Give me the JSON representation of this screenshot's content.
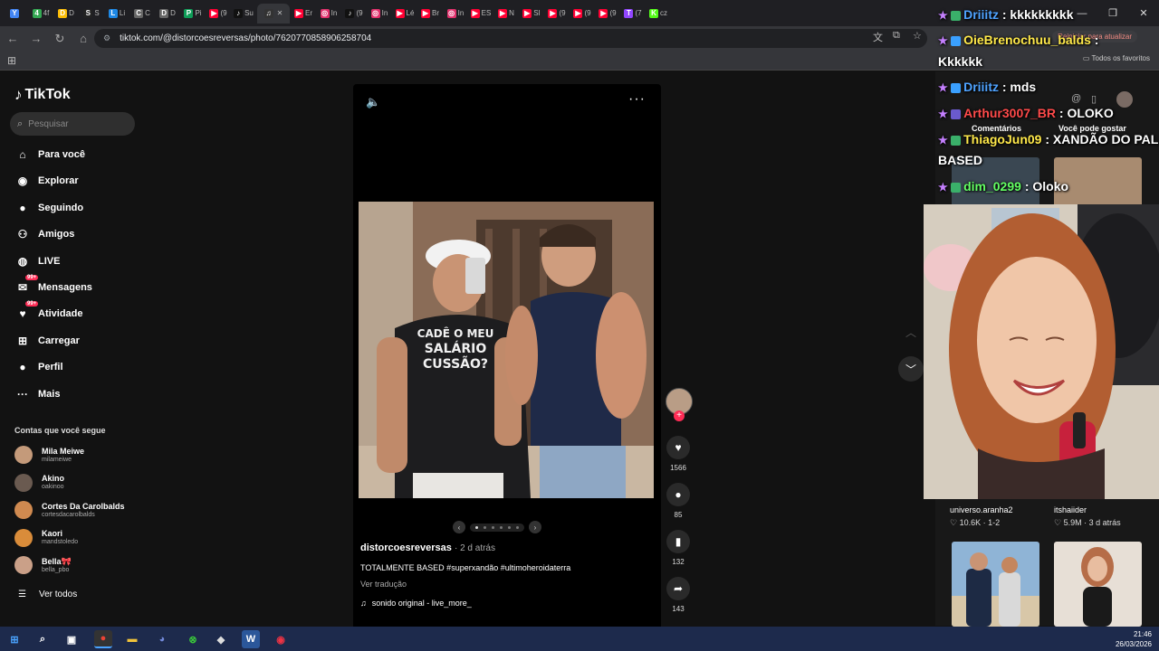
{
  "browser": {
    "url": "tiktok.com/@distorcoesreversas/photo/7620770858906258704",
    "update_label": "Reiniciar para atualizar",
    "favorites_label": "Todos os favoritos",
    "tabs": [
      {
        "fav": "Y",
        "color": "#4285f4",
        "text": ""
      },
      {
        "fav": "4",
        "color": "#34a853",
        "text": "4f"
      },
      {
        "fav": "D",
        "color": "#fbbc05",
        "text": "D"
      },
      {
        "fav": "S",
        "color": "#222",
        "text": "S"
      },
      {
        "fav": "L",
        "color": "#1e88e5",
        "text": "Li"
      },
      {
        "fav": "C",
        "color": "#666",
        "text": "C"
      },
      {
        "fav": "D",
        "color": "#666",
        "text": "D"
      },
      {
        "fav": "P",
        "color": "#0f9d58",
        "text": "Pi"
      },
      {
        "fav": "▶",
        "color": "#ff0033",
        "text": "(9"
      },
      {
        "fav": "♪",
        "color": "#111",
        "text": "Su"
      },
      {
        "fav": "♫",
        "color": "#333",
        "text": ""
      },
      {
        "fav": "▶",
        "color": "#ff0033",
        "text": "Er"
      },
      {
        "fav": "◎",
        "color": "#e1306c",
        "text": "In"
      },
      {
        "fav": "♪",
        "color": "#111",
        "text": "(9"
      },
      {
        "fav": "◎",
        "color": "#e1306c",
        "text": "In"
      },
      {
        "fav": "▶",
        "color": "#ff0033",
        "text": "Lé"
      },
      {
        "fav": "▶",
        "color": "#ff0033",
        "text": "Br"
      },
      {
        "fav": "◎",
        "color": "#e1306c",
        "text": "In"
      },
      {
        "fav": "▶",
        "color": "#ff0033",
        "text": "ES"
      },
      {
        "fav": "▶",
        "color": "#ff0033",
        "text": "N"
      },
      {
        "fav": "▶",
        "color": "#ff0033",
        "text": "SI"
      },
      {
        "fav": "▶",
        "color": "#ff0033",
        "text": "(9"
      },
      {
        "fav": "▶",
        "color": "#ff0033",
        "text": "(9"
      },
      {
        "fav": "▶",
        "color": "#ff0033",
        "text": "(9"
      },
      {
        "fav": "T",
        "color": "#9146ff",
        "text": "(7"
      },
      {
        "fav": "K",
        "color": "#53fc18",
        "text": "cz"
      }
    ]
  },
  "tiktok": {
    "logo": "TikTok",
    "search_placeholder": "Pesquisar",
    "nav": [
      {
        "icon": "home-icon",
        "glyph": "⌂",
        "label": "Para você",
        "badge": ""
      },
      {
        "icon": "compass-icon",
        "glyph": "◉",
        "label": "Explorar",
        "badge": ""
      },
      {
        "icon": "following-icon",
        "glyph": "●",
        "label": "Seguindo",
        "badge": ""
      },
      {
        "icon": "friends-icon",
        "glyph": "⚇",
        "label": "Amigos",
        "badge": ""
      },
      {
        "icon": "live-icon",
        "glyph": "◍",
        "label": "LIVE",
        "badge": ""
      },
      {
        "icon": "messages-icon",
        "glyph": "✉",
        "label": "Mensagens",
        "badge": "99+"
      },
      {
        "icon": "activity-icon",
        "glyph": "♥",
        "label": "Atividade",
        "badge": "99+"
      },
      {
        "icon": "upload-icon",
        "glyph": "⊞",
        "label": "Carregar",
        "badge": ""
      },
      {
        "icon": "profile-icon",
        "glyph": "●",
        "label": "Perfil",
        "badge": ""
      },
      {
        "icon": "more-icon",
        "glyph": "···",
        "label": "Mais",
        "badge": ""
      }
    ],
    "follows_title": "Contas que você segue",
    "follows": [
      {
        "name": "Mila Meiwe",
        "handle": "milameiwe",
        "color": "#c49a7a"
      },
      {
        "name": "Akino",
        "handle": "oakinoo",
        "color": "#6a5a50"
      },
      {
        "name": "Cortes Da Carolbalds",
        "handle": "cortesdacarolbalds",
        "color": "#d08a50"
      },
      {
        "name": "Kaori",
        "handle": "mandstoledo",
        "color": "#d98c3a"
      },
      {
        "name": "Bella🎀",
        "handle": "bella_pbo",
        "color": "#caa088"
      }
    ],
    "see_all": "Ver todos",
    "post": {
      "author": "distorcoesreversas",
      "time": "· 2 d atrás",
      "caption": "TOTALMENTE BASED #superxandão #ultimoheroidaterra",
      "translate": "Ver tradução",
      "sound": "sonido original - live_more_",
      "shirt_text": [
        "CADÊ O MEU",
        "SALÁRIO",
        "CUSSÃO?"
      ],
      "carousel_total": 6,
      "carousel_current": 1
    },
    "actions": {
      "likes": "1566",
      "comments": "85",
      "saves": "132",
      "shares": "143"
    },
    "right_panel": {
      "tab_comments": "Comentários",
      "tab_recommend": "Você pode gostar",
      "recs": [
        {
          "title": "universo.aranha2",
          "meta": "♡ 10.6K · 1-2"
        },
        {
          "title": "itshaiider",
          "meta": "♡ 5.9M · 3 d atrás"
        }
      ]
    }
  },
  "stream_chat": [
    {
      "user": "Driiitz",
      "msg": ": kkkkkkkkk",
      "color": "#4fa3ff"
    },
    {
      "user": "OieBrenochuu_balds",
      "msg": ":",
      "color": "#ffe94a"
    },
    {
      "user": "",
      "msg": "Kkkkkk",
      "color": "#fff"
    },
    {
      "user": "Driiitz",
      "msg": ": mds",
      "color": "#4fa3ff"
    },
    {
      "user": "Arthur3007_BR",
      "msg": ": OLOKO",
      "color": "#ff4a4a"
    },
    {
      "user": "ThiagoJun09",
      "msg": ": XANDÃO DO PAL",
      "color": "#ffe94a"
    },
    {
      "user": "",
      "msg": "BASED",
      "color": "#fff"
    },
    {
      "user": "dim_0299",
      "msg": ": Oloko",
      "color": "#63ff63"
    }
  ],
  "taskbar": {
    "time": "21:46",
    "date": "26/03/2026"
  }
}
